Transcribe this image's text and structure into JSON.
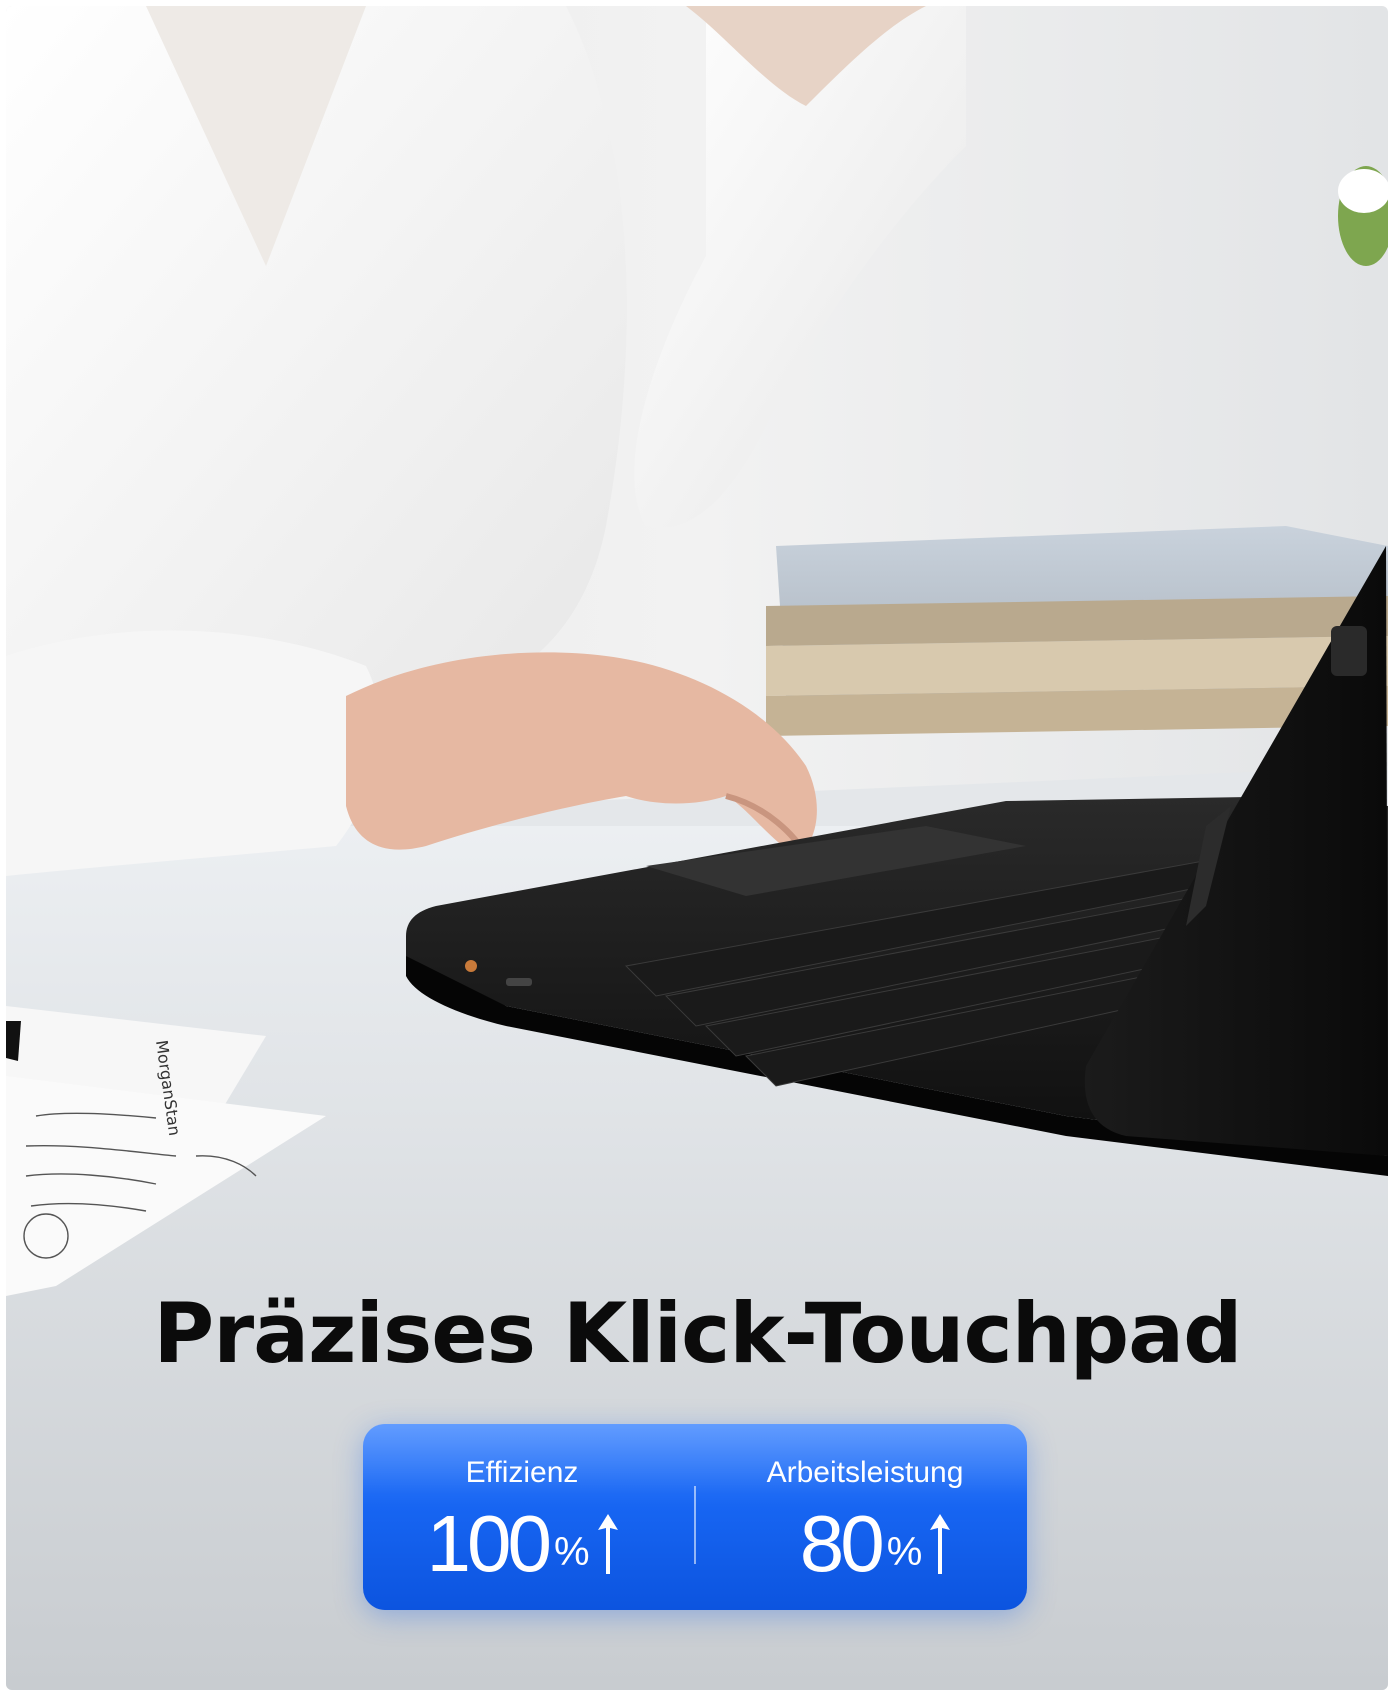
{
  "headline": "Präzises Klick-Touchpad",
  "stats": {
    "left": {
      "label": "Effizienz",
      "value": "100",
      "unit": "%",
      "trend_icon": "arrow-up-icon"
    },
    "right": {
      "label": "Arbeitsleistung",
      "value": "80",
      "unit": "%",
      "trend_icon": "arrow-up-icon"
    }
  },
  "paper_note": {
    "brand": "MorganStan"
  },
  "colors": {
    "card_blue": "#1765f2",
    "headline": "#0b0b0b"
  }
}
